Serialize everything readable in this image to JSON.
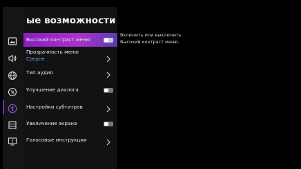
{
  "screen_title": "ые возможности",
  "sidebar_icons": [
    {
      "name": "picture-icon"
    },
    {
      "name": "sound-icon"
    },
    {
      "name": "globe-icon"
    },
    {
      "name": "support-icon"
    },
    {
      "name": "accessibility-icon",
      "selected": true
    },
    {
      "name": "menu-list-icon"
    },
    {
      "name": "help-icon"
    }
  ],
  "menu": {
    "items": [
      {
        "label": "Высокий контраст меню",
        "control": "toggle",
        "active": true
      },
      {
        "label": "Прозрачность меню",
        "value": "Средне",
        "control": "chevron"
      },
      {
        "label": "Тип аудио",
        "control": "chevron"
      },
      {
        "label": "Улучшение диалога",
        "control": "toggle"
      },
      {
        "label": "Настройки субтитров",
        "control": "chevron"
      },
      {
        "label": "Увеличение экрана",
        "control": "toggle"
      },
      {
        "label": "Голосовые инструкции",
        "control": "chevron"
      }
    ]
  },
  "tooltip": {
    "line1": "Включить или выключить",
    "line2": "Высокий контраст меню."
  },
  "colors": {
    "highlight": "#9a2bc8",
    "selected_indicator": "#7b2cc6",
    "value_text": "#6aa4ff",
    "panel_bg": "#121212"
  }
}
